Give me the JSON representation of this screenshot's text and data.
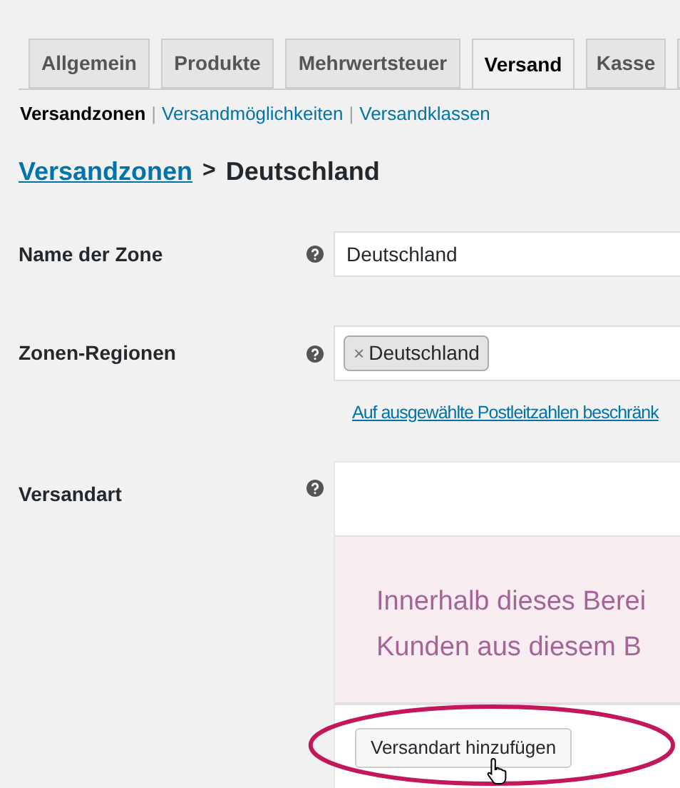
{
  "tabs": [
    {
      "label": "Allgemein",
      "selected": false
    },
    {
      "label": "Produkte",
      "selected": false
    },
    {
      "label": "Mehrwertsteuer",
      "selected": false
    },
    {
      "label": "Versand",
      "selected": true
    },
    {
      "label": "Kasse",
      "selected": false
    }
  ],
  "subnav": [
    {
      "label": "Versandzonen",
      "selected": true
    },
    {
      "label": "Versandmöglichkeiten",
      "selected": false
    },
    {
      "label": "Versandklassen",
      "selected": false
    }
  ],
  "subnav_separator": "|",
  "breadcrumb": {
    "link": "Versandzonen",
    "separator": ">",
    "current": "Deutschland"
  },
  "form": {
    "zone_name": {
      "label": "Name der Zone",
      "value": "Deutschland"
    },
    "zone_regions": {
      "label": "Zonen-Regionen",
      "tags": [
        {
          "label": "Deutschland",
          "remove": "×"
        }
      ],
      "link": "Auf ausgewählte Postleitzahlen beschränk"
    },
    "shipping_method": {
      "label": "Versandart",
      "notice_lines": [
        "Innerhalb dieses Berei",
        "Kunden aus diesem B"
      ],
      "button": "Versandart hinzufügen"
    }
  }
}
